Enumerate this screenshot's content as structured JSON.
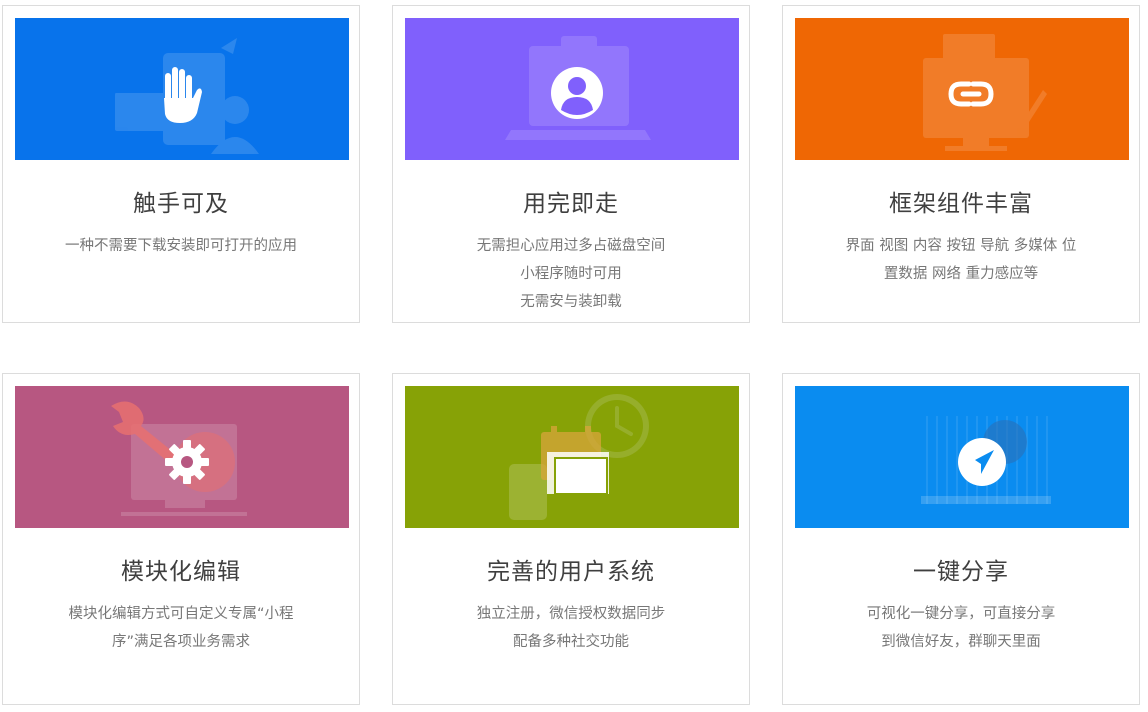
{
  "colors": {
    "blue": "#0873eb",
    "purple": "#8060fc",
    "orange": "#ef6704",
    "pink": "#b75781",
    "olive": "#87a206",
    "skyblue": "#0a8cf0"
  },
  "cards": [
    {
      "title": "触手可及",
      "desc": [
        "一种不需要下载安装即可打开的应用"
      ],
      "icon": "hand-icon"
    },
    {
      "title": "用完即走",
      "desc": [
        "无需担心应用过多占磁盘空间",
        "小程序随时可用",
        "无需安与装卸载"
      ],
      "icon": "user-icon"
    },
    {
      "title": "框架组件丰富",
      "desc": [
        "界面 视图 内容 按钮 导航 多媒体 位",
        "置数据 网络 重力感应等"
      ],
      "icon": "link-icon"
    },
    {
      "title": "模块化编辑",
      "desc": [
        "模块化编辑方式可自定义专属“小程",
        "序”满足各项业务需求"
      ],
      "icon": "gear-icon"
    },
    {
      "title": "完善的用户系统",
      "desc": [
        "独立注册，微信授权数据同步",
        "配备多种社交功能"
      ],
      "icon": "windows-icon"
    },
    {
      "title": "一键分享",
      "desc": [
        "可视化一键分享，可直接分享",
        "到微信好友，群聊天里面"
      ],
      "icon": "navigation-arrow-icon"
    }
  ]
}
